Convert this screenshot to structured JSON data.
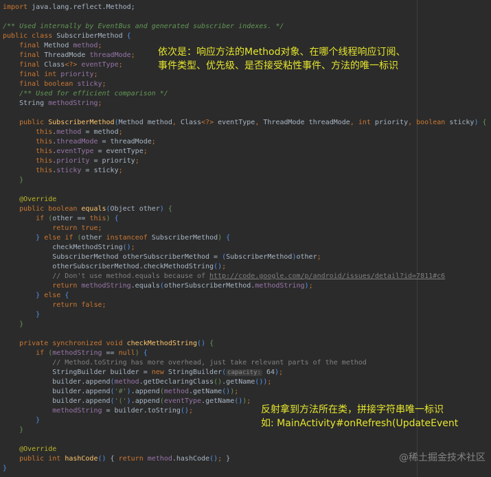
{
  "editor": {
    "colors": {
      "background": "#2b2b2b",
      "keyword": "#cc7832",
      "field": "#9876aa",
      "method": "#ffc66d",
      "doc_comment": "#629755",
      "annotation": "#bbb529",
      "note": "#e6e62e"
    }
  },
  "code_lines": [
    [
      [
        "k",
        "import "
      ],
      [
        "t",
        "java.lang.reflect.Method;"
      ]
    ],
    [],
    [
      [
        "c",
        "/** Used internally by EventBus and generated subscriber indexes. */"
      ]
    ],
    [
      [
        "k",
        "public class "
      ],
      [
        "t",
        "SubscriberMethod "
      ],
      [
        "b",
        "{"
      ]
    ],
    [
      [
        "k",
        "    final "
      ],
      [
        "t",
        "Method "
      ],
      [
        "f",
        "method"
      ],
      [
        "k",
        ";"
      ]
    ],
    [
      [
        "k",
        "    final "
      ],
      [
        "t",
        "ThreadMode "
      ],
      [
        "f",
        "threadMode"
      ],
      [
        "k",
        ";"
      ]
    ],
    [
      [
        "k",
        "    final "
      ],
      [
        "t",
        "Class"
      ],
      [
        "k",
        "<?> "
      ],
      [
        "f",
        "eventType"
      ],
      [
        "k",
        ";"
      ]
    ],
    [
      [
        "k",
        "    final int "
      ],
      [
        "f",
        "priority"
      ],
      [
        "k",
        ";"
      ]
    ],
    [
      [
        "k",
        "    final boolean "
      ],
      [
        "f",
        "sticky"
      ],
      [
        "k",
        ";"
      ]
    ],
    [
      [
        "c",
        "    /** Used for efficient comparison */"
      ]
    ],
    [
      [
        "t",
        "    String "
      ],
      [
        "f",
        "methodString"
      ],
      [
        "k",
        ";"
      ]
    ],
    [],
    [
      [
        "k",
        "    public "
      ],
      [
        "m",
        "SubscriberMethod"
      ],
      [
        "b",
        "("
      ],
      [
        "t",
        "Method method"
      ],
      [
        "k",
        ", "
      ],
      [
        "t",
        "Class"
      ],
      [
        "k",
        "<?> "
      ],
      [
        "t",
        "eventType"
      ],
      [
        "k",
        ", "
      ],
      [
        "t",
        "ThreadMode threadMode"
      ],
      [
        "k",
        ", int "
      ],
      [
        "t",
        "priority"
      ],
      [
        "k",
        ", boolean "
      ],
      [
        "t",
        "sticky"
      ],
      [
        "b",
        ")"
      ],
      [
        "t",
        " "
      ],
      [
        "g",
        "{"
      ]
    ],
    [
      [
        "k",
        "        this"
      ],
      [
        "t",
        "."
      ],
      [
        "f",
        "method"
      ],
      [
        "t",
        " = method"
      ],
      [
        "k",
        ";"
      ]
    ],
    [
      [
        "k",
        "        this"
      ],
      [
        "t",
        "."
      ],
      [
        "f",
        "threadMode"
      ],
      [
        "t",
        " = threadMode"
      ],
      [
        "k",
        ";"
      ]
    ],
    [
      [
        "k",
        "        this"
      ],
      [
        "t",
        "."
      ],
      [
        "f",
        "eventType"
      ],
      [
        "t",
        " = eventType"
      ],
      [
        "k",
        ";"
      ]
    ],
    [
      [
        "k",
        "        this"
      ],
      [
        "t",
        "."
      ],
      [
        "f",
        "priority"
      ],
      [
        "t",
        " = priority"
      ],
      [
        "k",
        ";"
      ]
    ],
    [
      [
        "k",
        "        this"
      ],
      [
        "t",
        "."
      ],
      [
        "f",
        "sticky"
      ],
      [
        "t",
        " = sticky"
      ],
      [
        "k",
        ";"
      ]
    ],
    [
      [
        "g",
        "    }"
      ]
    ],
    [],
    [
      [
        "a",
        "    @Override"
      ]
    ],
    [
      [
        "k",
        "    public boolean "
      ],
      [
        "m",
        "equals"
      ],
      [
        "b",
        "("
      ],
      [
        "t",
        "Object other"
      ],
      [
        "b",
        ")"
      ],
      [
        "t",
        " "
      ],
      [
        "g",
        "{"
      ]
    ],
    [
      [
        "k",
        "        if "
      ],
      [
        "g",
        "("
      ],
      [
        "t",
        "other == "
      ],
      [
        "k",
        "this"
      ],
      [
        "g",
        ")"
      ],
      [
        "t",
        " "
      ],
      [
        "b",
        "{"
      ]
    ],
    [
      [
        "k",
        "            return true;"
      ]
    ],
    [
      [
        "b",
        "        } "
      ],
      [
        "k",
        "else if "
      ],
      [
        "g",
        "("
      ],
      [
        "t",
        "other "
      ],
      [
        "k",
        "instanceof "
      ],
      [
        "t",
        "SubscriberMethod"
      ],
      [
        "g",
        ")"
      ],
      [
        "t",
        " "
      ],
      [
        "b",
        "{"
      ]
    ],
    [
      [
        "t",
        "            checkMethodString"
      ],
      [
        "b",
        "()"
      ],
      [
        "k",
        ";"
      ]
    ],
    [
      [
        "t",
        "            SubscriberMethod otherSubscriberMethod = "
      ],
      [
        "b",
        "("
      ],
      [
        "t",
        "SubscriberMethod"
      ],
      [
        "b",
        ")"
      ],
      [
        "t",
        "other"
      ],
      [
        "k",
        ";"
      ]
    ],
    [
      [
        "t",
        "            otherSubscriberMethod.checkMethodString"
      ],
      [
        "b",
        "()"
      ],
      [
        "k",
        ";"
      ]
    ],
    [
      [
        "lc",
        "            // Don't use method.equals because of "
      ],
      [
        "u",
        "http://code.google.com/p/android/issues/detail?id=7811#c6"
      ]
    ],
    [
      [
        "k",
        "            return "
      ],
      [
        "f",
        "methodString"
      ],
      [
        "t",
        ".equals"
      ],
      [
        "b",
        "("
      ],
      [
        "t",
        "otherSubscriberMethod."
      ],
      [
        "f",
        "methodString"
      ],
      [
        "b",
        ")"
      ],
      [
        "k",
        ";"
      ]
    ],
    [
      [
        "b",
        "        } "
      ],
      [
        "k",
        "else "
      ],
      [
        "b",
        "{"
      ]
    ],
    [
      [
        "k",
        "            return false;"
      ]
    ],
    [
      [
        "b",
        "        }"
      ]
    ],
    [
      [
        "g",
        "    }"
      ]
    ],
    [],
    [
      [
        "k",
        "    private synchronized void "
      ],
      [
        "m",
        "checkMethodString"
      ],
      [
        "b",
        "()"
      ],
      [
        "t",
        " "
      ],
      [
        "g",
        "{"
      ]
    ],
    [
      [
        "k",
        "        if "
      ],
      [
        "g",
        "("
      ],
      [
        "f",
        "methodString"
      ],
      [
        "t",
        " == "
      ],
      [
        "k",
        "null"
      ],
      [
        "g",
        ")"
      ],
      [
        "t",
        " "
      ],
      [
        "b",
        "{"
      ]
    ],
    [
      [
        "lc",
        "            // Method.toString has more overhead, just take relevant parts of the method"
      ]
    ],
    [
      [
        "t",
        "            StringBuilder builder = "
      ],
      [
        "k",
        "new "
      ],
      [
        "t",
        "StringBuilder"
      ],
      [
        "b",
        "("
      ],
      [
        "h",
        "capacity:"
      ],
      [
        "t",
        " 64"
      ],
      [
        "b",
        ")"
      ],
      [
        "k",
        ";"
      ]
    ],
    [
      [
        "t",
        "            builder.append"
      ],
      [
        "b",
        "("
      ],
      [
        "f",
        "method"
      ],
      [
        "t",
        ".getDeclaringClass"
      ],
      [
        "g",
        "()"
      ],
      [
        "t",
        ".getName"
      ],
      [
        "b",
        "()"
      ],
      [
        "b",
        ")"
      ],
      [
        "k",
        ";"
      ]
    ],
    [
      [
        "t",
        "            builder.append"
      ],
      [
        "b",
        "("
      ],
      [
        "s",
        "'#'"
      ],
      [
        "b",
        ")"
      ],
      [
        "t",
        ".append"
      ],
      [
        "g",
        "("
      ],
      [
        "f",
        "method"
      ],
      [
        "t",
        ".getName"
      ],
      [
        "b",
        "()"
      ],
      [
        "g",
        ")"
      ],
      [
        "k",
        ";"
      ]
    ],
    [
      [
        "t",
        "            builder.append"
      ],
      [
        "b",
        "("
      ],
      [
        "s",
        "'('"
      ],
      [
        "b",
        ")"
      ],
      [
        "t",
        ".append"
      ],
      [
        "g",
        "("
      ],
      [
        "f",
        "eventType"
      ],
      [
        "t",
        ".getName"
      ],
      [
        "b",
        "()"
      ],
      [
        "g",
        ")"
      ],
      [
        "k",
        ";"
      ]
    ],
    [
      [
        "f",
        "            methodString"
      ],
      [
        "t",
        " = builder.toString"
      ],
      [
        "b",
        "()"
      ],
      [
        "k",
        ";"
      ]
    ],
    [
      [
        "b",
        "        }"
      ]
    ],
    [
      [
        "g",
        "    }"
      ]
    ],
    [],
    [
      [
        "a",
        "    @Override"
      ]
    ],
    [
      [
        "k",
        "    public int "
      ],
      [
        "m",
        "hashCode"
      ],
      [
        "b",
        "()"
      ],
      [
        "t",
        " { "
      ],
      [
        "k",
        "return "
      ],
      [
        "f",
        "method"
      ],
      [
        "t",
        ".hashCode"
      ],
      [
        "b",
        "()"
      ],
      [
        "k",
        ";"
      ],
      [
        "t",
        " }"
      ]
    ],
    [
      [
        "b",
        "}"
      ]
    ]
  ],
  "notes": {
    "fields_note": "依次是：响应方法的Method对象、在哪个线程响应订阅、\n事件类型、优先级、是否接受粘性事件、方法的唯一标识",
    "method_string_note": "反射拿到方法所在类，拼接字符串唯一标识\n如: MainActivity#onRefresh(UpdateEvent"
  },
  "watermark": "@稀土掘金技术社区"
}
